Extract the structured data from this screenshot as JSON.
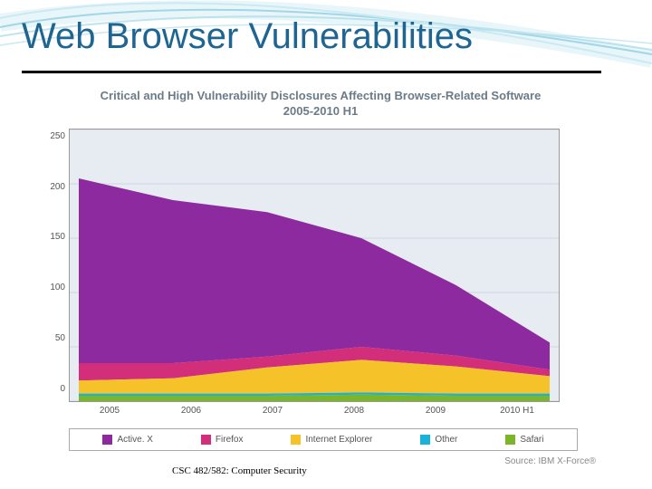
{
  "slide": {
    "title": "Web Browser Vulnerabilities",
    "footer": "CSC 482/582: Computer Security"
  },
  "figure": {
    "title_line1": "Critical and High Vulnerability Disclosures Affecting Browser-Related Software",
    "title_line2": "2005-2010 H1",
    "source": "Source: IBM X-Force®"
  },
  "legend": {
    "items": [
      {
        "name": "Active. X",
        "color": "#8d2aa0"
      },
      {
        "name": "Firefox",
        "color": "#d22e7a"
      },
      {
        "name": "Internet Explorer",
        "color": "#f6c22a"
      },
      {
        "name": "Other",
        "color": "#19b2d8"
      },
      {
        "name": "Safari",
        "color": "#7ab52a"
      }
    ]
  },
  "chart_data": {
    "type": "area",
    "title": "Critical and High Vulnerability Disclosures Affecting Browser-Related Software 2005-2010 H1",
    "xlabel": "",
    "ylabel": "",
    "categories": [
      "2005",
      "2006",
      "2007",
      "2008",
      "2009",
      "2010 H1"
    ],
    "ylim": [
      0,
      250
    ],
    "yticks": [
      0,
      50,
      100,
      150,
      200,
      250
    ],
    "series": [
      {
        "name": "Safari",
        "color": "#7ab52a",
        "values": [
          5,
          5,
          5,
          6,
          5,
          5
        ]
      },
      {
        "name": "Other",
        "color": "#19b2d8",
        "values": [
          2,
          2,
          2,
          2,
          2,
          2
        ]
      },
      {
        "name": "Internet Explorer",
        "color": "#f6c22a",
        "values": [
          12,
          14,
          24,
          30,
          25,
          16
        ]
      },
      {
        "name": "Firefox",
        "color": "#d22e7a",
        "values": [
          16,
          14,
          10,
          12,
          10,
          6
        ]
      },
      {
        "name": "Active. X",
        "color": "#8d2aa0",
        "values": [
          170,
          150,
          133,
          100,
          65,
          25
        ]
      }
    ]
  }
}
